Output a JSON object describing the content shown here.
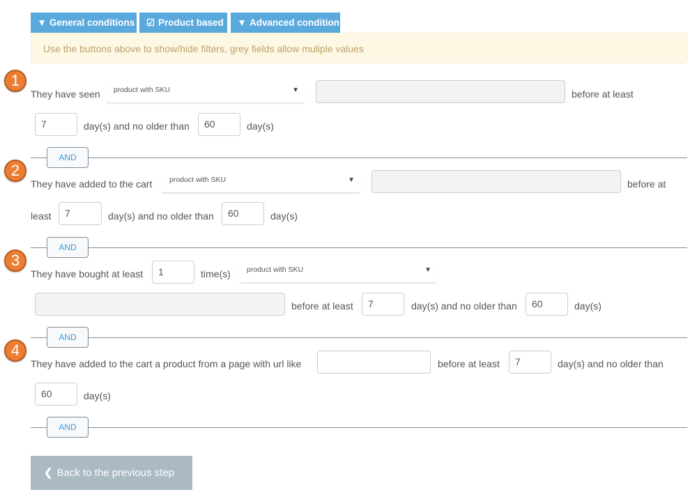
{
  "tabs": [
    {
      "label": "General conditions",
      "icon": "filter-icon"
    },
    {
      "label": "Product based",
      "icon": "checkbox-icon"
    },
    {
      "label": "Advanced condition",
      "icon": "filter-icon"
    }
  ],
  "alert": "Use the buttons above to show/hide filters, grey fields allow muliple values",
  "conditions": [
    {
      "number": "1",
      "text": "They have seen",
      "select": "product with SKU",
      "before": "before at least",
      "min_days": "7",
      "mid": "day(s) and no older than",
      "max_days": "60",
      "days": "day(s)"
    },
    {
      "number": "2",
      "text": "They have added to the cart",
      "select": "product with SKU",
      "before_a": "before at",
      "before_b": "least",
      "min_days": "7",
      "mid": "day(s) and no older than",
      "max_days": "60",
      "days": "day(s)"
    },
    {
      "number": "3",
      "text": "They have bought at least",
      "times": "1",
      "times_label": "time(s)",
      "select": "product with SKU",
      "before": "before at least",
      "min_days": "7",
      "mid": "day(s) and no older than",
      "max_days": "60",
      "days": "day(s)"
    },
    {
      "number": "4",
      "text": "They have added to the cart a product from a page with url like",
      "url": "",
      "before": "before at least",
      "min_days": "7",
      "mid": "day(s) and no older than",
      "max_days": "60",
      "days": "day(s)"
    }
  ],
  "and_label": "AND",
  "back_label": "Back to the previous step"
}
